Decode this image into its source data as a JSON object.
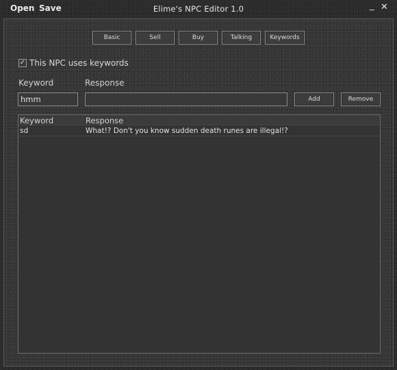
{
  "menu": {
    "open": "Open",
    "save": "Save"
  },
  "window": {
    "title": "Elime's NPC Editor 1.0",
    "minimize": "_",
    "close": "✕"
  },
  "tabs": [
    {
      "label": "Basic"
    },
    {
      "label": "Sell"
    },
    {
      "label": "Buy"
    },
    {
      "label": "Talking"
    },
    {
      "label": "Keywords"
    }
  ],
  "keywords_enabled": {
    "label": "This NPC uses keywords",
    "checked": true,
    "mark": "✓"
  },
  "form": {
    "keyword_label": "Keyword",
    "response_label": "Response",
    "keyword_value": "hmm",
    "response_value": "",
    "add_label": "Add",
    "remove_label": "Remove"
  },
  "table": {
    "columns": [
      "Keyword",
      "Response"
    ],
    "rows": [
      {
        "keyword": "sd",
        "response": "What!? Don't you know sudden death runes are illegal!?"
      }
    ]
  }
}
